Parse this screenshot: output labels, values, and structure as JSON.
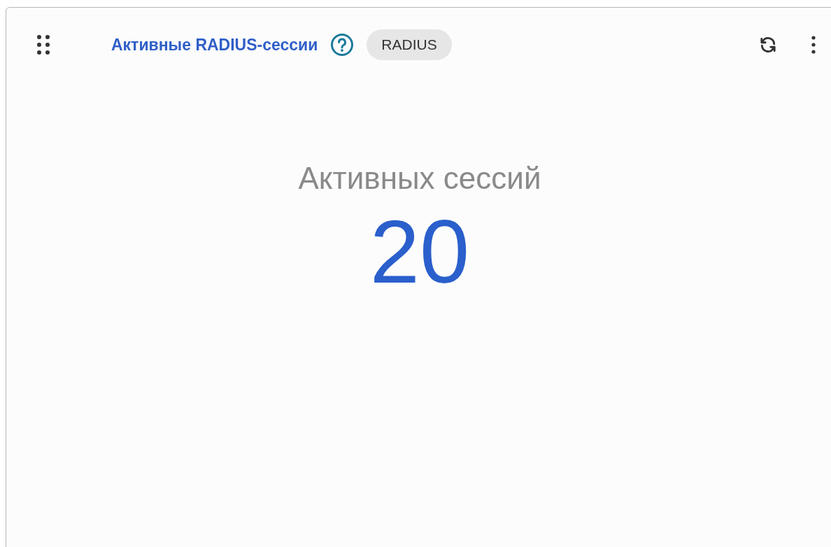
{
  "widget": {
    "title": "Активные RADIUS-сессии",
    "tag": "RADIUS",
    "metric": {
      "label": "Активных сессий",
      "value": "20"
    }
  }
}
